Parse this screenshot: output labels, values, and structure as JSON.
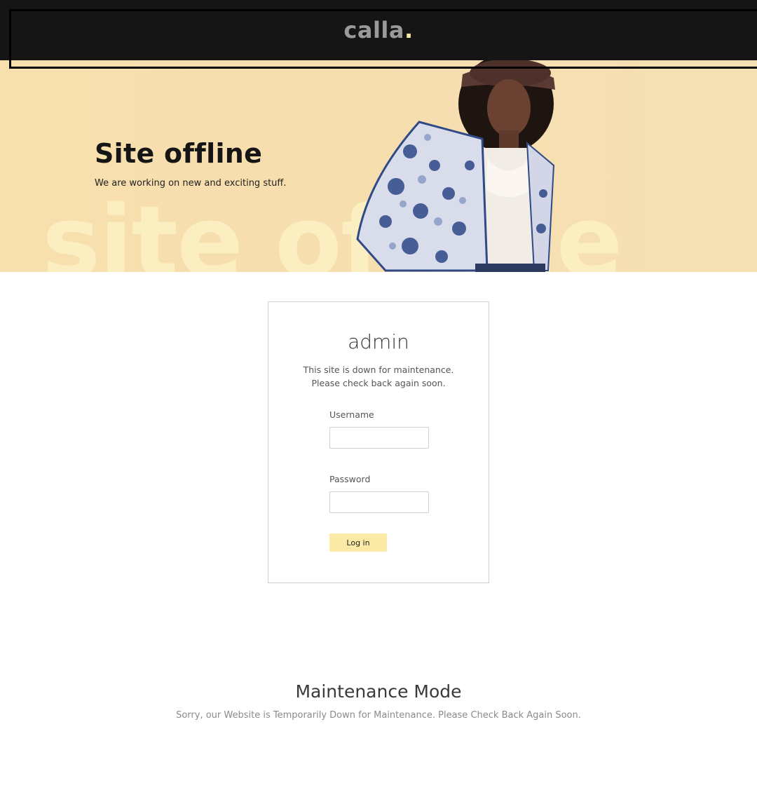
{
  "header": {
    "logo_text": "calla",
    "logo_dot": ".",
    "accent_color": "#f7e7a8",
    "background_color": "#151515"
  },
  "hero": {
    "title": "Site offline",
    "subtitle": "We are working on new and exciting stuff.",
    "watermark": "site offline",
    "background_color": "#f7dfae",
    "image": "woman-in-paisley-jacket-photo"
  },
  "login_card": {
    "title": "admin",
    "message_line1": "This site is down for maintenance.",
    "message_line2": "Please check back again soon.",
    "username_label": "Username",
    "username_value": "",
    "password_label": "Password",
    "password_value": "",
    "login_button": "Log in",
    "button_color": "#fbe9a6"
  },
  "footer": {
    "title": "Maintenance Mode",
    "message": "Sorry, our Website is Temporarily Down for Maintenance. Please Check Back Again Soon."
  }
}
